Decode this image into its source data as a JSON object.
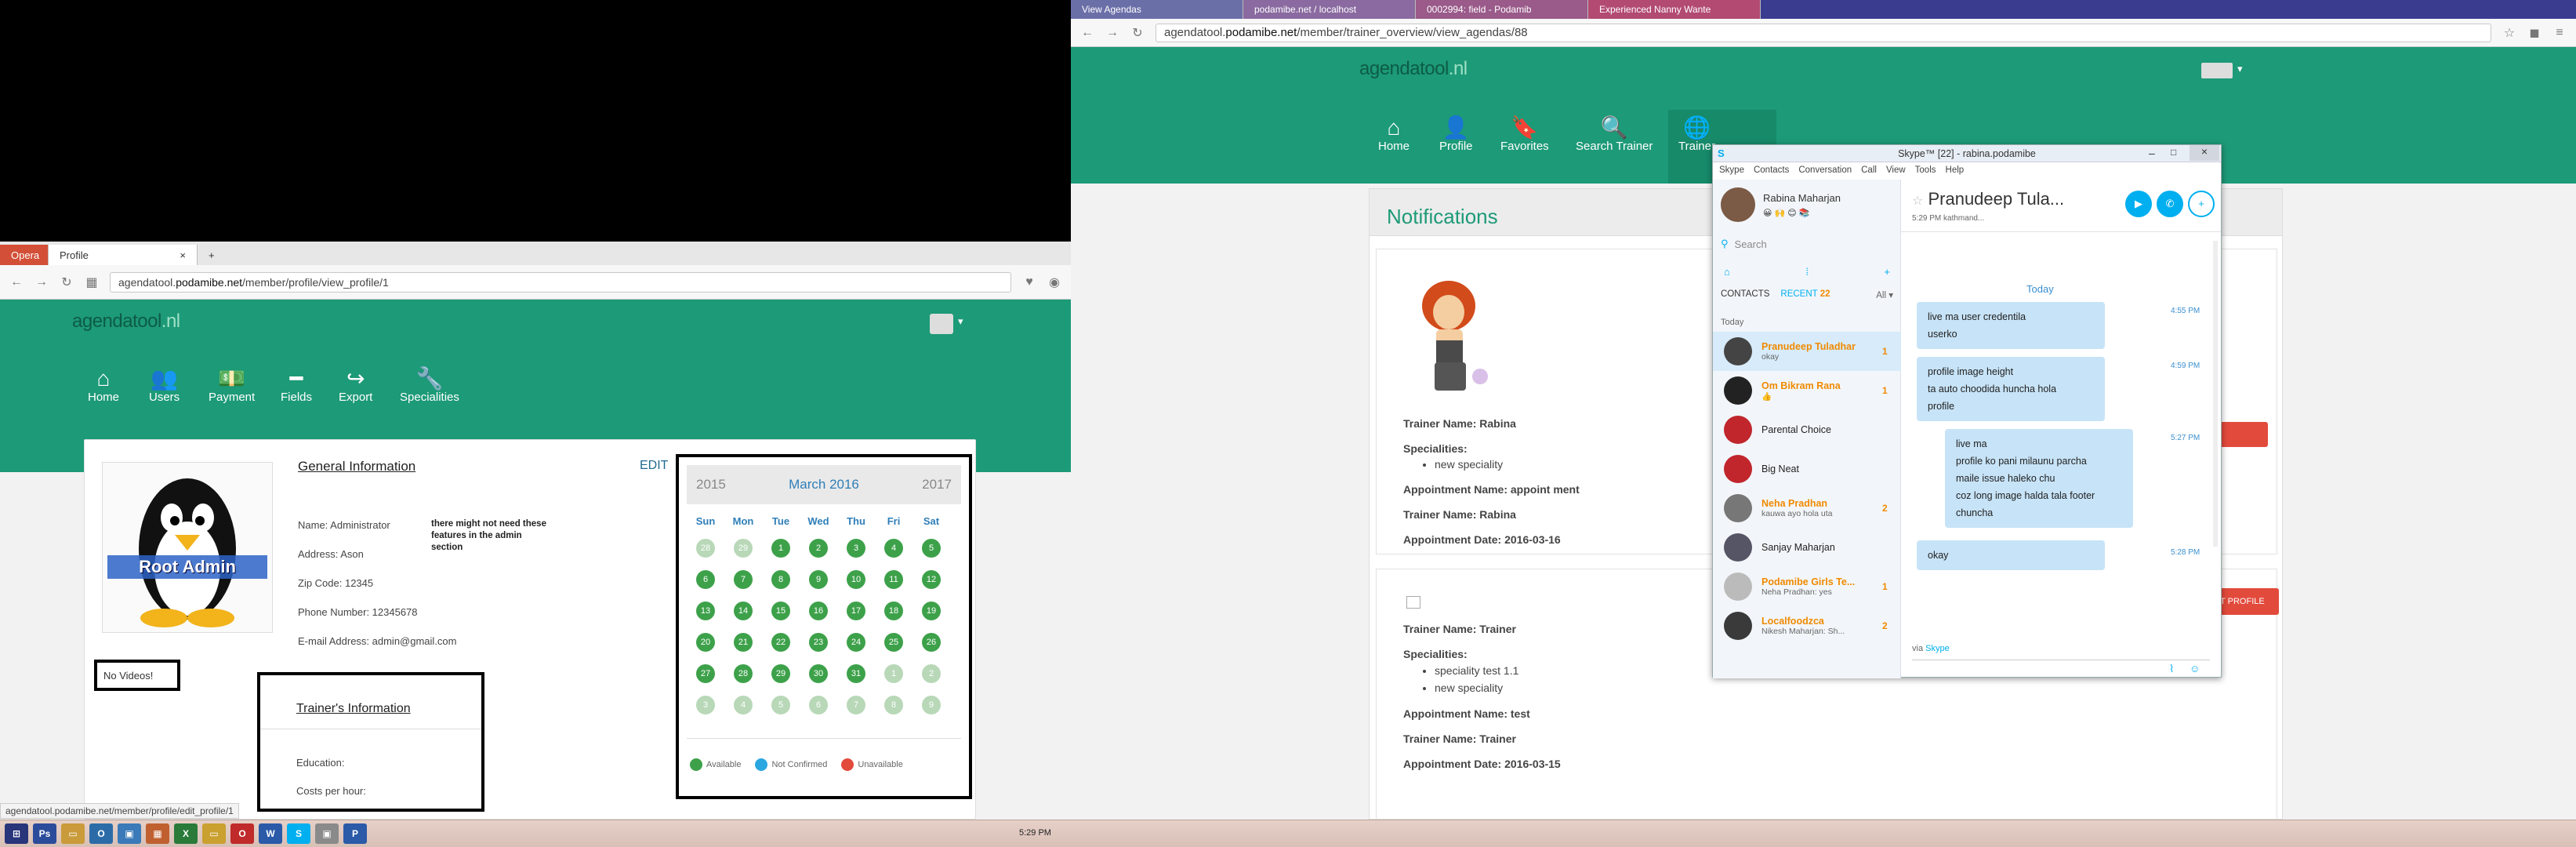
{
  "left": {
    "tabs": [
      {
        "label": "Opera"
      },
      {
        "label": "Profile"
      }
    ],
    "url_prefix": "agendatool.",
    "url_domain": "podamibe.net",
    "url_path": "/member/profile/view_profile/1",
    "logo_main": "agendatool",
    "logo_tld": ".nl",
    "nav": [
      {
        "label": "Home",
        "icon": "⌂"
      },
      {
        "label": "Users",
        "icon": "👥"
      },
      {
        "label": "Payment",
        "icon": "💵"
      },
      {
        "label": "Fields",
        "icon": "━"
      },
      {
        "label": "Export",
        "icon": "↪"
      },
      {
        "label": "Specialities",
        "icon": "🔧"
      }
    ],
    "avatar_text": "Root Admin",
    "general_title": "General Information",
    "edit_label": "EDIT",
    "info": [
      "Name: Administrator",
      "Address: Ason",
      "Zip Code: 12345",
      "Phone Number: 12345678",
      "E-mail Address: admin@gmail.com"
    ],
    "note": "there might not need these features in the admin section",
    "no_videos": "No Videos!",
    "trainer_title": "Trainer's Information",
    "education_label": "Education:",
    "cost_label": "Costs per hour:",
    "cal_prev": "2015",
    "cal_title": "March 2016",
    "cal_next": "2017",
    "cal_days": [
      "Sun",
      "Mon",
      "Tue",
      "Wed",
      "Thu",
      "Fri",
      "Sat"
    ],
    "cal_rows": [
      [
        "28",
        "29",
        "1",
        "2",
        "3",
        "4",
        "5"
      ],
      [
        "6",
        "7",
        "8",
        "9",
        "10",
        "11",
        "12"
      ],
      [
        "13",
        "14",
        "15",
        "16",
        "17",
        "18",
        "19"
      ],
      [
        "20",
        "21",
        "22",
        "23",
        "24",
        "25",
        "26"
      ],
      [
        "27",
        "28",
        "29",
        "30",
        "31",
        "1",
        "2"
      ],
      [
        "3",
        "4",
        "5",
        "6",
        "7",
        "8",
        "9"
      ]
    ],
    "legend": [
      {
        "label": "Available",
        "color": "#3da14a"
      },
      {
        "label": "Not Confirmed",
        "color": "#2aa7e0"
      },
      {
        "label": "Unavailable",
        "color": "#e24a3c"
      }
    ],
    "status_url": "agendatool.podamibe.net/member/profile/edit_profile/1",
    "clock": "5:29 PM"
  },
  "right": {
    "tabs": [
      {
        "label": "View Agendas"
      },
      {
        "label": "podamibe.net / localhost"
      },
      {
        "label": "0002994: field - Podamib"
      },
      {
        "label": "Experienced Nanny Wante"
      }
    ],
    "url_prefix": "agendatool.",
    "url_domain": "podamibe.net",
    "url_path": "/member/trainer_overview/view_agendas/88",
    "logo_main": "agendatool",
    "logo_tld": ".nl",
    "nav": [
      {
        "label": "Home",
        "icon": "⌂"
      },
      {
        "label": "Profile",
        "icon": "👤"
      },
      {
        "label": "Favorites",
        "icon": "🔖"
      },
      {
        "label": "Search Trainer",
        "icon": "🔍"
      },
      {
        "label": "Trainer",
        "icon": "🌐"
      }
    ],
    "notifications_title": "Notifications",
    "n1": {
      "trainer": "Trainer Name: Rabina",
      "spec_label": "Specialities:",
      "specs": [
        "new speciality"
      ],
      "appt": "Appointment Name: appoint ment",
      "trainer2": "Trainer Name: Rabina",
      "date": "Appointment Date: 2016-03-16"
    },
    "n2": {
      "trainer": "Trainer Name: Trainer",
      "spec_label": "Specialities:",
      "specs": [
        "speciality test 1.1",
        "new speciality"
      ],
      "appt": "Appointment Name: test",
      "trainer2": "Trainer Name: Trainer",
      "date": "Appointment Date: 2016-03-15"
    },
    "visit_label": "VISIT PROFILE"
  },
  "skype": {
    "title": "Skype™ [22] - rabina.podamibe",
    "menu": [
      "Skype",
      "Contacts",
      "Conversation",
      "Call",
      "View",
      "Tools",
      "Help"
    ],
    "me": "Rabina Maharjan",
    "search": "Search",
    "tab_contacts": "CONTACTS",
    "tab_recent": "RECENT",
    "recent_count": "22",
    "filter": "All",
    "today": "Today",
    "contacts": [
      {
        "name": "Pranudeep Tuladhar",
        "sub": "okay",
        "badge": "1",
        "color": "#444"
      },
      {
        "name": "Om Bikram Rana",
        "sub": "👍",
        "badge": "1",
        "color": "#222"
      },
      {
        "name": "Parental Choice",
        "sub": "",
        "badge": "",
        "color": "#c0262c"
      },
      {
        "name": "Big Neat",
        "sub": "",
        "badge": "",
        "color": "#c0262c"
      },
      {
        "name": "Neha Pradhan",
        "sub": "kauwa ayo hola uta",
        "badge": "2",
        "color": "#777"
      },
      {
        "name": "Sanjay Maharjan",
        "sub": "",
        "badge": "",
        "color": "#556"
      },
      {
        "name": "Podamibe Girls Te...",
        "sub": "Neha Pradhan: yes",
        "badge": "1",
        "color": "#bbb"
      },
      {
        "name": "Localfoodzca",
        "sub": "Nikesh Maharjan: Sh...",
        "badge": "2",
        "color": "#3a3a3a"
      }
    ],
    "chat_name": "Pranudeep Tula...",
    "chat_sub": "5:29 PM kathmand...",
    "chat_today": "Today",
    "messages": [
      {
        "lines": [
          "live ma user credentila",
          "userko"
        ],
        "time": "4:55 PM"
      },
      {
        "lines": [
          "profile image height",
          "ta auto choodida huncha hola",
          "profile"
        ],
        "time": "4:59 PM"
      },
      {
        "lines": [
          "live ma",
          "profile ko pani milaunu parcha",
          "maile issue haleko chu",
          "coz long image halda tala footer",
          "chuncha"
        ],
        "time": "5:27 PM"
      },
      {
        "lines": [
          "okay"
        ],
        "time": "5:28 PM"
      }
    ],
    "via": "via",
    "via_app": "Skype"
  }
}
